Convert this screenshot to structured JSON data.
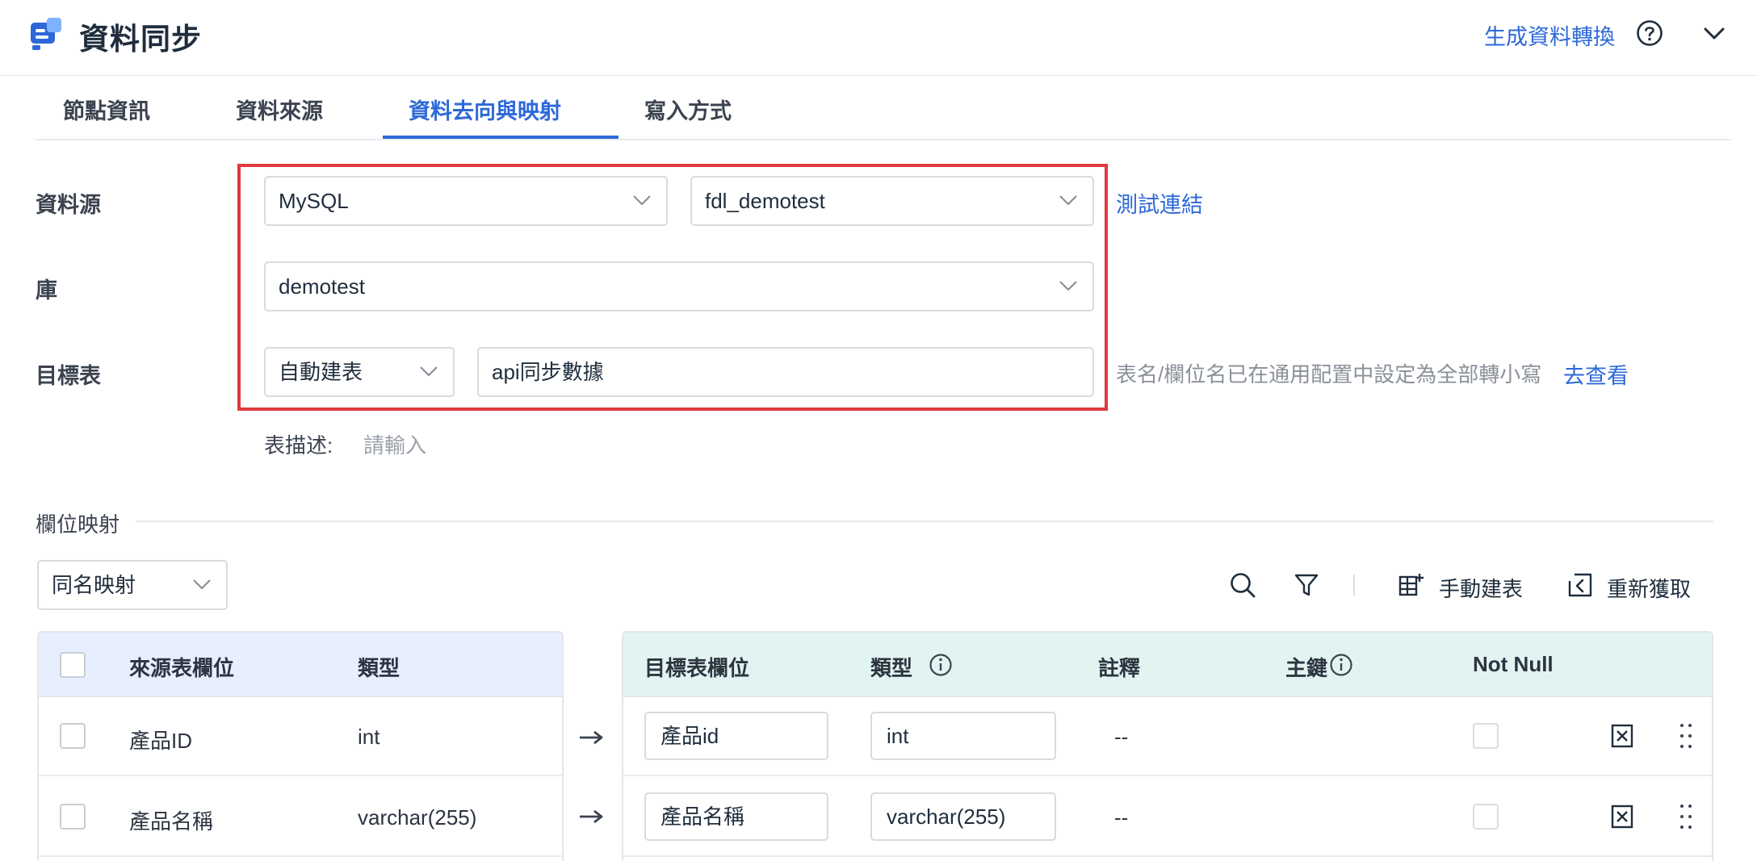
{
  "app": {
    "title": "資料同步",
    "generate_link": "生成資料轉換"
  },
  "tabs": [
    "節點資訊",
    "資料來源",
    "資料去向與映射",
    "寫入方式"
  ],
  "form": {
    "datasource_label": "資料源",
    "db_type": "MySQL",
    "connection": "fdl_demotest",
    "test_link": "測試連結",
    "database_label": "庫",
    "database": "demotest",
    "target_label": "目標表",
    "create_mode": "自動建表",
    "table_name": "api同步數據",
    "hint": "表名/欄位名已在通用配置中設定為全部轉小寫",
    "view_link": "去查看",
    "desc_label": "表描述:",
    "desc_placeholder": "請輸入"
  },
  "mapping": {
    "section_title": "欄位映射",
    "mode": "同名映射",
    "manual_create": "手動建表",
    "refetch": "重新獲取",
    "source_headers": [
      "來源表欄位",
      "類型"
    ],
    "target_headers": [
      "目標表欄位",
      "類型",
      "註釋",
      "主鍵",
      "Not Null"
    ],
    "rows": [
      {
        "src_field": "產品ID",
        "src_type": "int",
        "tgt_field": "產品id",
        "tgt_type": "int",
        "comment": "--"
      },
      {
        "src_field": "產品名稱",
        "src_type": "varchar(255)",
        "tgt_field": "產品名稱",
        "tgt_type": "varchar(255)",
        "comment": "--"
      }
    ]
  },
  "colors": {
    "accent": "#2d68d8",
    "highlight_border": "#e0393e",
    "source_header_bg": "#e7efff",
    "target_header_bg": "#e1f4f1"
  }
}
